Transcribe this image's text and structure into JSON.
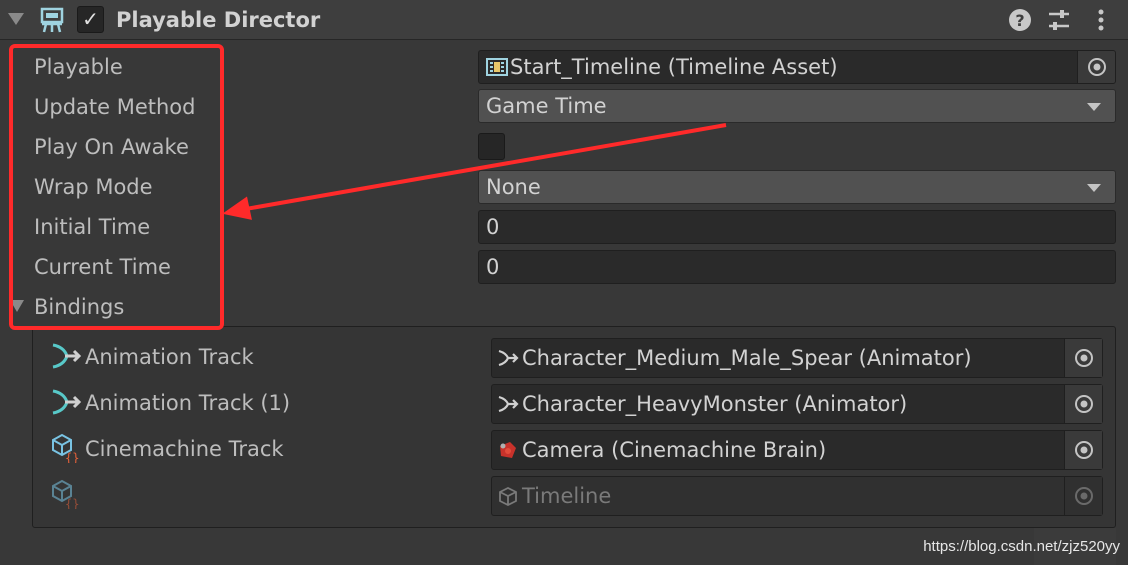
{
  "header": {
    "title": "Playable Director",
    "enabled": true,
    "icons": [
      "director-icon",
      "help-icon",
      "preset-icon",
      "kebab-menu-icon"
    ]
  },
  "properties": [
    {
      "label": "Playable",
      "value": "Start_Timeline (Timeline Asset)",
      "kind": "object-field",
      "icon": "timeline-asset-icon"
    },
    {
      "label": "Update Method",
      "value": "Game Time",
      "kind": "dropdown"
    },
    {
      "label": "Play On Awake",
      "value": false,
      "kind": "checkbox"
    },
    {
      "label": "Wrap Mode",
      "value": "None",
      "kind": "dropdown"
    },
    {
      "label": "Initial Time",
      "value": "0",
      "kind": "number"
    },
    {
      "label": "Current Time",
      "value": "0",
      "kind": "number"
    }
  ],
  "bindings": {
    "label": "Bindings",
    "items": [
      {
        "track": "Animation Track",
        "track_icon": "animation-track-icon",
        "binding": "Character_Medium_Male_Spear (Animator)",
        "binding_icon": "animator-icon"
      },
      {
        "track": "Animation Track (1)",
        "track_icon": "animation-track-icon",
        "binding": "Character_HeavyMonster (Animator)",
        "binding_icon": "animator-icon"
      },
      {
        "track": "Cinemachine Track",
        "track_icon": "cinemachine-track-icon",
        "binding": "Camera (Cinemachine Brain)",
        "binding_icon": "cinemachine-brain-icon"
      },
      {
        "track": "",
        "track_icon": "cinemachine-track-icon",
        "binding": "Timeline",
        "binding_icon": "timeline-object-icon",
        "disabled": true
      }
    ]
  },
  "annotation": {
    "color": "#ff2a2a"
  },
  "watermark": "https://blog.csdn.net/zjz520yy",
  "colors": {
    "background": "#383838",
    "field": "#2a2a2a",
    "dropdown": "#515151",
    "text": "#c4c4c4"
  }
}
